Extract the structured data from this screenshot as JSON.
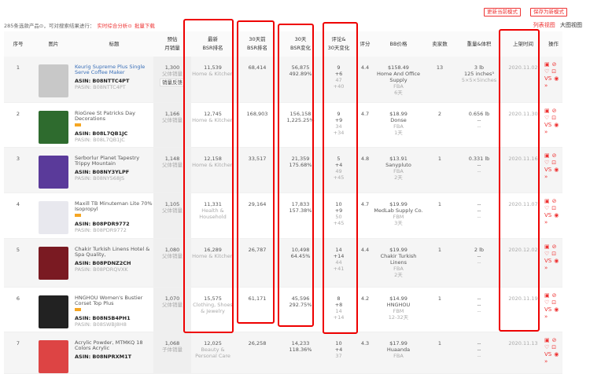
{
  "toolbar": {
    "update_mode": "更新当前模式",
    "save_mode": "保存为新模式",
    "list_view": "列表视图",
    "big_view": "大图视图"
  },
  "info": {
    "count_text": "285条选款产品⊙，可对搜索结果进行：",
    "analysis": "实时综合分析⊙",
    "download": "批量下载"
  },
  "headers": [
    "序号",
    "图片",
    "标题",
    "预估\n月销量",
    "最新\nBSR排名",
    "30天前\nBSR排名",
    "30天\nBSR变化",
    "评论&\n30天变化",
    "评分",
    "BB价格",
    "卖家数",
    "重量&体积",
    "上架时间",
    "操作"
  ],
  "rows": [
    {
      "no": "1",
      "title": "Keurig Supreme Plus Single Serve Coffee Maker",
      "asin": "ASIN: B08NTTC4PT",
      "pasin": "PASIN: B08NTTC4PT",
      "badge": false,
      "sales": "1,300",
      "sales_type": "父体销量",
      "sales_btn": "销量反馈",
      "bsr": "11,539",
      "cat": "Home & Kitchen",
      "bsr30": "68,414",
      "chg": "56,875",
      "chg_pct": "492.89%",
      "rev": "9",
      "rev_chg": "+6",
      "rat_cnt": "47",
      "rat_chg": "+40",
      "rating": "4.4",
      "price": "$158.49",
      "seller": "Home And Office Supply",
      "ship": "FBA",
      "days": "6天",
      "sellers": "13",
      "weight": "3 lb",
      "vol": "125 inches³",
      "dims": "5×5×5inches",
      "date": "2020.11.02",
      "img": "#c8c8c8"
    },
    {
      "no": "2",
      "title": "RioGree St Patricks Day Decorations",
      "asin": "ASIN: B08L7QB1JC",
      "pasin": "PASIN: B08L7QB1JC",
      "badge": true,
      "sales": "1,166",
      "sales_type": "父体销量",
      "bsr": "12,745",
      "cat": "Home & Kitchen",
      "bsr30": "168,903",
      "chg": "156,158",
      "chg_pct": "1,225.25%",
      "rev": "9",
      "rev_chg": "+9",
      "rat_cnt": "34",
      "rat_chg": "+34",
      "rating": "4.7",
      "price": "$18.99",
      "seller": "Donse",
      "ship": "FBA",
      "days": "1天",
      "sellers": "2",
      "weight": "0.656 lb",
      "vol": "--",
      "dims": "--",
      "date": "2020.11.30",
      "img": "#2e6b2e"
    },
    {
      "no": "3",
      "title": "Serborlur Planet Tapestry Trippy Mountain",
      "asin": "ASIN: B08NY3YLPF",
      "pasin": "PASIN: B08NY568JS",
      "badge": false,
      "sales": "1,148",
      "sales_type": "父体销量",
      "bsr": "12,158",
      "cat": "Home & Kitchen",
      "bsr30": "33,517",
      "chg": "21,359",
      "chg_pct": "175.68%",
      "rev": "5",
      "rev_chg": "+4",
      "rat_cnt": "49",
      "rat_chg": "+45",
      "rating": "4.8",
      "price": "$13.91",
      "seller": "Sanypluto",
      "ship": "FBA",
      "days": "2天",
      "sellers": "1",
      "weight": "0.331 lb",
      "vol": "--",
      "dims": "--",
      "date": "2020.11.16",
      "img": "#5a3a9a"
    },
    {
      "no": "4",
      "title": "Maxill TB Minuteman Lite 70% Isopropyl",
      "asin": "ASIN: B08PDR9772",
      "pasin": "PASIN: B08PDR9772",
      "badge": true,
      "sales": "1,105",
      "sales_type": "父体销量",
      "bsr": "11,331",
      "cat": "Health & Household",
      "bsr30": "29,164",
      "chg": "17,833",
      "chg_pct": "157.38%",
      "rev": "10",
      "rev_chg": "+9",
      "rat_cnt": "50",
      "rat_chg": "+45",
      "rating": "4.7",
      "price": "$19.99",
      "seller": "MedLab Supply Co.",
      "ship": "FBM",
      "days": "3天",
      "sellers": "1",
      "weight": "--",
      "vol": "--",
      "dims": "--",
      "date": "2020.11.07",
      "img": "#e8e8ee"
    },
    {
      "no": "5",
      "title": "Chakir Turkish Linens Hotel & Spa Quality,",
      "asin": "ASIN: B08PDNZ2CH",
      "pasin": "PASIN: B08PDRQVXK",
      "badge": false,
      "sales": "1,080",
      "sales_type": "父体销量",
      "bsr": "16,289",
      "cat": "Home & Kitchen",
      "bsr30": "26,787",
      "chg": "10,498",
      "chg_pct": "64.45%",
      "rev": "14",
      "rev_chg": "+14",
      "rat_cnt": "44",
      "rat_chg": "+41",
      "rating": "4.4",
      "price": "$19.99",
      "seller": "Chakir Turkish Linens",
      "ship": "FBA",
      "days": "2天",
      "sellers": "1",
      "weight": "2 lb",
      "vol": "--",
      "dims": "--",
      "date": "2020.12.02",
      "img": "#7a1a22"
    },
    {
      "no": "6",
      "title": "HNGHOU Women's Bustier Corset Top Plus",
      "asin": "ASIN: B08N5B4PH1",
      "pasin": "PASIN: B08SWBJ8H8",
      "badge": true,
      "sales": "1,070",
      "sales_type": "父体销量",
      "bsr": "15,575",
      "cat": "Clothing, Shoes & Jewelry",
      "bsr30": "61,171",
      "chg": "45,596",
      "chg_pct": "292.75%",
      "rev": "8",
      "rev_chg": "+8",
      "rat_cnt": "14",
      "rat_chg": "+14",
      "rating": "4.2",
      "price": "$14.99",
      "seller": "HNGHOU",
      "ship": "FBM",
      "days": "12-32天",
      "sellers": "1",
      "weight": "--",
      "vol": "--",
      "dims": "--",
      "date": "2020.11.19",
      "img": "#222"
    },
    {
      "no": "7",
      "title": "Acrylic Powder, MTMKQ 18 Colors Acrylic",
      "asin": "ASIN: B08NPRXM1T",
      "pasin": "",
      "badge": false,
      "sales": "1,068",
      "sales_type": "子体销量",
      "bsr": "12,025",
      "cat": "Beauty & Personal Care",
      "bsr30": "26,258",
      "chg": "14,233",
      "chg_pct": "118.36%",
      "rev": "10",
      "rev_chg": "+4",
      "rat_cnt": "37",
      "rat_chg": "",
      "rating": "4.3",
      "price": "$17.99",
      "seller": "Huaanda",
      "ship": "FBA",
      "days": "",
      "sellers": "1",
      "weight": "--",
      "vol": "--",
      "dims": "--",
      "date": "2020.11.13",
      "img": "#d44"
    }
  ],
  "ops": [
    "▣",
    "⊘",
    "♡",
    "⊡",
    "VS",
    "◉",
    "»"
  ],
  "colors": {
    "accent": "#e33",
    "highlight": "#e00"
  }
}
